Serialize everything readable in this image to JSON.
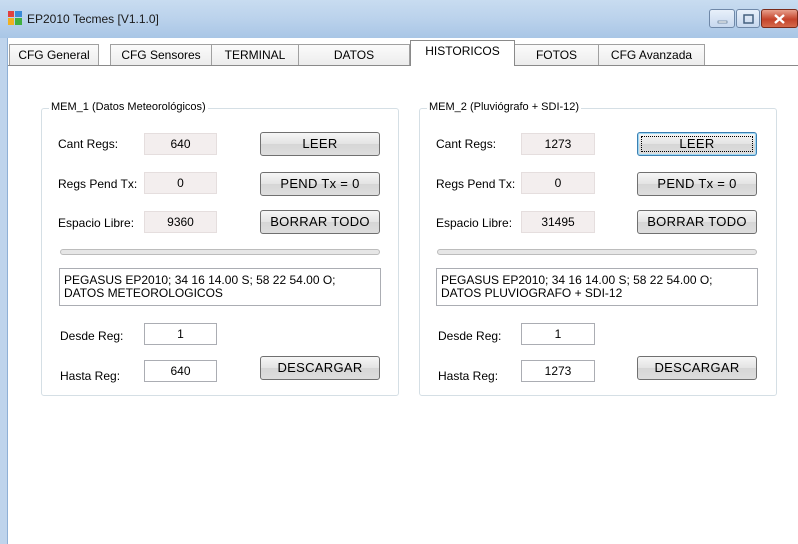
{
  "window": {
    "title": "EP2010 Tecmes  [V1.1.0]"
  },
  "tabs": [
    {
      "label": "CFG General",
      "active": false
    },
    {
      "label": "CFG Sensores",
      "active": false
    },
    {
      "label": "TERMINAL",
      "active": false
    },
    {
      "label": "DATOS",
      "active": false
    },
    {
      "label": "HISTORICOS",
      "active": true
    },
    {
      "label": "FOTOS",
      "active": false
    },
    {
      "label": "CFG Avanzada",
      "active": false
    }
  ],
  "mem1": {
    "legend": "MEM_1 (Datos Meteorológicos)",
    "cant_regs_label": "Cant Regs:",
    "cant_regs_value": "640",
    "regs_pend_label": "Regs Pend Tx:",
    "regs_pend_value": "0",
    "espacio_label": "Espacio Libre:",
    "espacio_value": "9360",
    "leer_label": "LEER",
    "pend_label": "PEND Tx = 0",
    "borrar_label": "BORRAR TODO",
    "progress": 0,
    "info_line1": "PEGASUS EP2010; 34 16 14.00 S; 58 22 54.00 O;",
    "info_line2": "DATOS METEOROLOGICOS",
    "desde_label": "Desde Reg:",
    "desde_value": "1",
    "hasta_label": "Hasta Reg:",
    "hasta_value": "640",
    "descargar_label": "DESCARGAR"
  },
  "mem2": {
    "legend": "MEM_2 (Pluviógrafo + SDI-12)",
    "cant_regs_label": "Cant Regs:",
    "cant_regs_value": "1273",
    "regs_pend_label": "Regs Pend Tx:",
    "regs_pend_value": "0",
    "espacio_label": "Espacio Libre:",
    "espacio_value": "31495",
    "leer_label": "LEER",
    "pend_label": "PEND Tx = 0",
    "borrar_label": "BORRAR TODO",
    "progress": 0,
    "info_line1": "PEGASUS EP2010; 34 16 14.00 S; 58 22 54.00 O;",
    "info_line2": "DATOS PLUVIOGRAFO + SDI-12",
    "desde_label": "Desde Reg:",
    "desde_value": "1",
    "hasta_label": "Hasta Reg:",
    "hasta_value": "1273",
    "descargar_label": "DESCARGAR"
  },
  "colors": {
    "titlebar": "#bcd3ec",
    "close_button": "#c4432a",
    "readonly_field": "#f3eeee"
  }
}
